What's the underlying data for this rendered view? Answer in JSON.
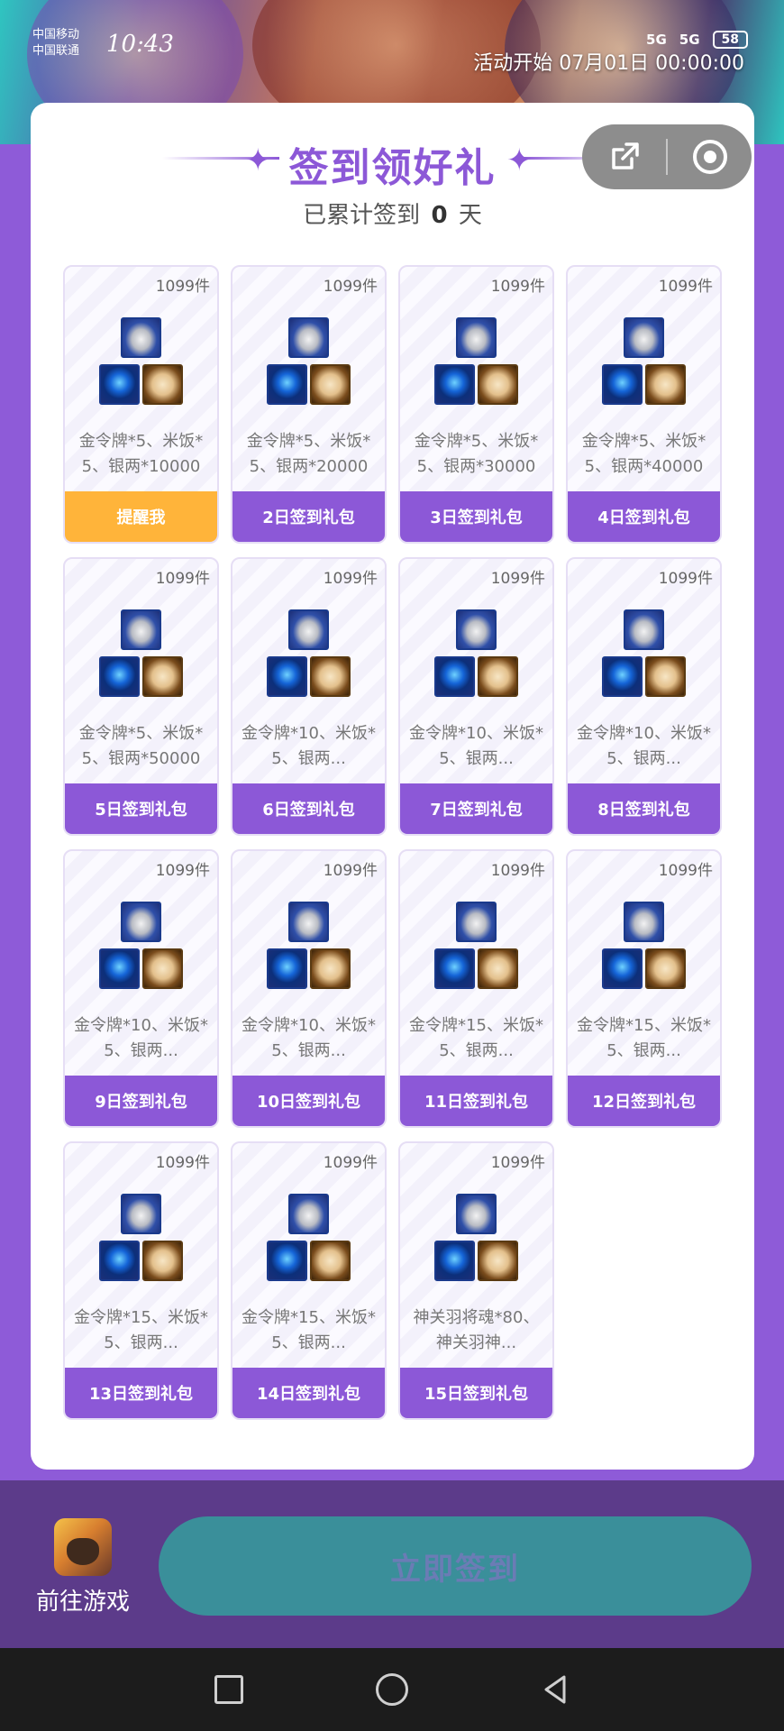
{
  "status_bar": {
    "carrier1": "中国移动",
    "carrier2": "中国联通",
    "time": "10:43",
    "net1": "5G",
    "net2": "5G",
    "battery": "58"
  },
  "banner": {
    "activity_time": "活动开始 07月01日 00:00:00"
  },
  "header": {
    "title": "签到领好礼",
    "subtitle_prefix": "已累计签到",
    "days": "0",
    "subtitle_suffix": "天"
  },
  "capsule": {
    "share_icon": "share-icon",
    "close_icon": "target-icon"
  },
  "gifts": [
    {
      "stock": "1099件",
      "desc": "金令牌*5、米饭*5、银两*10000",
      "button": "提醒我"
    },
    {
      "stock": "1099件",
      "desc": "金令牌*5、米饭*5、银两*20000",
      "button": "2日签到礼包"
    },
    {
      "stock": "1099件",
      "desc": "金令牌*5、米饭*5、银两*30000",
      "button": "3日签到礼包"
    },
    {
      "stock": "1099件",
      "desc": "金令牌*5、米饭*5、银两*40000",
      "button": "4日签到礼包"
    },
    {
      "stock": "1099件",
      "desc": "金令牌*5、米饭*5、银两*50000",
      "button": "5日签到礼包"
    },
    {
      "stock": "1099件",
      "desc": "金令牌*10、米饭*5、银两...",
      "button": "6日签到礼包"
    },
    {
      "stock": "1099件",
      "desc": "金令牌*10、米饭*5、银两...",
      "button": "7日签到礼包"
    },
    {
      "stock": "1099件",
      "desc": "金令牌*10、米饭*5、银两...",
      "button": "8日签到礼包"
    },
    {
      "stock": "1099件",
      "desc": "金令牌*10、米饭*5、银两...",
      "button": "9日签到礼包"
    },
    {
      "stock": "1099件",
      "desc": "金令牌*10、米饭*5、银两...",
      "button": "10日签到礼包"
    },
    {
      "stock": "1099件",
      "desc": "金令牌*15、米饭*5、银两...",
      "button": "11日签到礼包"
    },
    {
      "stock": "1099件",
      "desc": "金令牌*15、米饭*5、银两...",
      "button": "12日签到礼包"
    },
    {
      "stock": "1099件",
      "desc": "金令牌*15、米饭*5、银两...",
      "button": "13日签到礼包"
    },
    {
      "stock": "1099件",
      "desc": "金令牌*15、米饭*5、银两...",
      "button": "14日签到礼包"
    },
    {
      "stock": "1099件",
      "desc": "神关羽将魂*80、神关羽神...",
      "button": "15日签到礼包"
    }
  ],
  "bottom": {
    "game_label": "前往游戏",
    "signin_label": "立即签到"
  },
  "colors": {
    "accent": "#8c58d7",
    "remind": "#ffb43a",
    "signin_button": "#3a8f9a"
  }
}
